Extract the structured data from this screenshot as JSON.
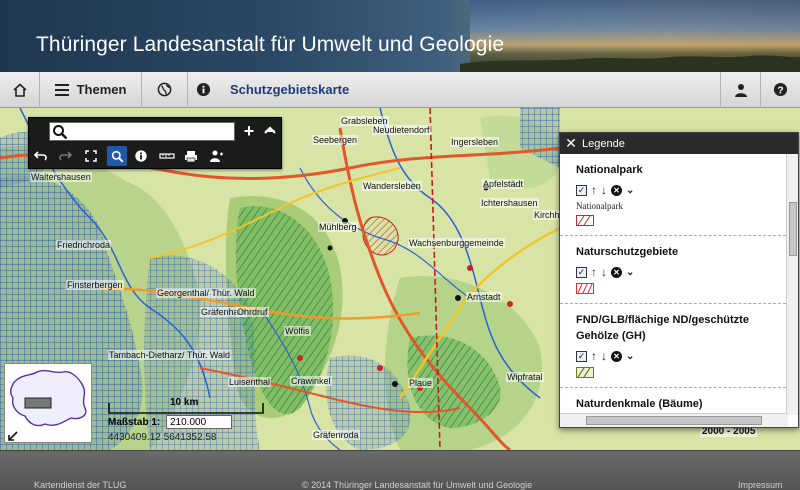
{
  "header": {
    "title": "Thüringer Landesanstalt für Umwelt und Geologie"
  },
  "nav": {
    "home_icon": "home-icon",
    "themen_label": "Themen",
    "map_title": "Schutzgebietskarte"
  },
  "toolbar": {
    "search_placeholder": "",
    "zoom_in": "+",
    "zoom_out": "−"
  },
  "map": {
    "places": [
      "Grabsleben",
      "Seebergen",
      "Neudietendorf",
      "Ingersleben",
      "Waltershausen",
      "Wandersleben",
      "Apfelstädt",
      "Ichtershausen",
      "Kirchh",
      "Mühlberg",
      "Friedrichroda",
      "Wachsenburggemeinde",
      "Finsterbergen",
      "Georgenthal/ Thür. Wald",
      "Arnstadt",
      "Gräfenhain",
      "Ohrdruf",
      "Wölfis",
      "Tambach-Dietharz/ Thür. Wald",
      "Crawinkel",
      "Luisenthal",
      "Plaue",
      "Wipfratal",
      "Gräfenroda"
    ],
    "scale_label": "10 km",
    "masstab_label": "Maßstab 1:",
    "masstab_value": "210.000",
    "coordinates": "4430409.12  5641352.58",
    "scale_corner": "2000 - 2005"
  },
  "legend": {
    "title": "Legende",
    "sections": [
      {
        "title": "Nationalpark",
        "sublabel": "Nationalpark",
        "color": "#b03030"
      },
      {
        "title": "Naturschutzgebiete",
        "color": "#e03030"
      },
      {
        "title": "FND/GLB/flächige ND/geschützte Gehölze (GH)",
        "color": "#6b7a1c"
      },
      {
        "title": "Naturdenkmale (Bäume)"
      }
    ]
  },
  "footer": {
    "left": "Kartendienst der TLUG",
    "center": "© 2014 Thüringer Landesanstalt für Umwelt und Geologie",
    "right": "Impressum"
  }
}
